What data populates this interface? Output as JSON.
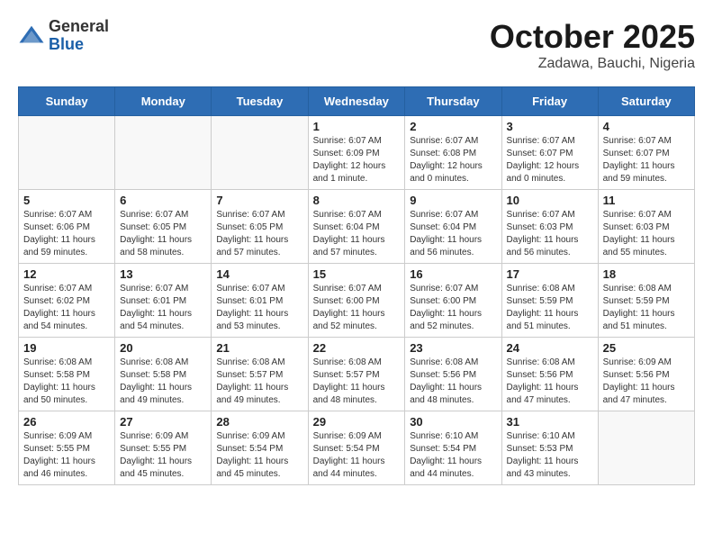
{
  "header": {
    "logo_general": "General",
    "logo_blue": "Blue",
    "month_title": "October 2025",
    "location": "Zadawa, Bauchi, Nigeria"
  },
  "days_of_week": [
    "Sunday",
    "Monday",
    "Tuesday",
    "Wednesday",
    "Thursday",
    "Friday",
    "Saturday"
  ],
  "weeks": [
    [
      {
        "day": "",
        "info": ""
      },
      {
        "day": "",
        "info": ""
      },
      {
        "day": "",
        "info": ""
      },
      {
        "day": "1",
        "info": "Sunrise: 6:07 AM\nSunset: 6:09 PM\nDaylight: 12 hours\nand 1 minute."
      },
      {
        "day": "2",
        "info": "Sunrise: 6:07 AM\nSunset: 6:08 PM\nDaylight: 12 hours\nand 0 minutes."
      },
      {
        "day": "3",
        "info": "Sunrise: 6:07 AM\nSunset: 6:07 PM\nDaylight: 12 hours\nand 0 minutes."
      },
      {
        "day": "4",
        "info": "Sunrise: 6:07 AM\nSunset: 6:07 PM\nDaylight: 11 hours\nand 59 minutes."
      }
    ],
    [
      {
        "day": "5",
        "info": "Sunrise: 6:07 AM\nSunset: 6:06 PM\nDaylight: 11 hours\nand 59 minutes."
      },
      {
        "day": "6",
        "info": "Sunrise: 6:07 AM\nSunset: 6:05 PM\nDaylight: 11 hours\nand 58 minutes."
      },
      {
        "day": "7",
        "info": "Sunrise: 6:07 AM\nSunset: 6:05 PM\nDaylight: 11 hours\nand 57 minutes."
      },
      {
        "day": "8",
        "info": "Sunrise: 6:07 AM\nSunset: 6:04 PM\nDaylight: 11 hours\nand 57 minutes."
      },
      {
        "day": "9",
        "info": "Sunrise: 6:07 AM\nSunset: 6:04 PM\nDaylight: 11 hours\nand 56 minutes."
      },
      {
        "day": "10",
        "info": "Sunrise: 6:07 AM\nSunset: 6:03 PM\nDaylight: 11 hours\nand 56 minutes."
      },
      {
        "day": "11",
        "info": "Sunrise: 6:07 AM\nSunset: 6:03 PM\nDaylight: 11 hours\nand 55 minutes."
      }
    ],
    [
      {
        "day": "12",
        "info": "Sunrise: 6:07 AM\nSunset: 6:02 PM\nDaylight: 11 hours\nand 54 minutes."
      },
      {
        "day": "13",
        "info": "Sunrise: 6:07 AM\nSunset: 6:01 PM\nDaylight: 11 hours\nand 54 minutes."
      },
      {
        "day": "14",
        "info": "Sunrise: 6:07 AM\nSunset: 6:01 PM\nDaylight: 11 hours\nand 53 minutes."
      },
      {
        "day": "15",
        "info": "Sunrise: 6:07 AM\nSunset: 6:00 PM\nDaylight: 11 hours\nand 52 minutes."
      },
      {
        "day": "16",
        "info": "Sunrise: 6:07 AM\nSunset: 6:00 PM\nDaylight: 11 hours\nand 52 minutes."
      },
      {
        "day": "17",
        "info": "Sunrise: 6:08 AM\nSunset: 5:59 PM\nDaylight: 11 hours\nand 51 minutes."
      },
      {
        "day": "18",
        "info": "Sunrise: 6:08 AM\nSunset: 5:59 PM\nDaylight: 11 hours\nand 51 minutes."
      }
    ],
    [
      {
        "day": "19",
        "info": "Sunrise: 6:08 AM\nSunset: 5:58 PM\nDaylight: 11 hours\nand 50 minutes."
      },
      {
        "day": "20",
        "info": "Sunrise: 6:08 AM\nSunset: 5:58 PM\nDaylight: 11 hours\nand 49 minutes."
      },
      {
        "day": "21",
        "info": "Sunrise: 6:08 AM\nSunset: 5:57 PM\nDaylight: 11 hours\nand 49 minutes."
      },
      {
        "day": "22",
        "info": "Sunrise: 6:08 AM\nSunset: 5:57 PM\nDaylight: 11 hours\nand 48 minutes."
      },
      {
        "day": "23",
        "info": "Sunrise: 6:08 AM\nSunset: 5:56 PM\nDaylight: 11 hours\nand 48 minutes."
      },
      {
        "day": "24",
        "info": "Sunrise: 6:08 AM\nSunset: 5:56 PM\nDaylight: 11 hours\nand 47 minutes."
      },
      {
        "day": "25",
        "info": "Sunrise: 6:09 AM\nSunset: 5:56 PM\nDaylight: 11 hours\nand 47 minutes."
      }
    ],
    [
      {
        "day": "26",
        "info": "Sunrise: 6:09 AM\nSunset: 5:55 PM\nDaylight: 11 hours\nand 46 minutes."
      },
      {
        "day": "27",
        "info": "Sunrise: 6:09 AM\nSunset: 5:55 PM\nDaylight: 11 hours\nand 45 minutes."
      },
      {
        "day": "28",
        "info": "Sunrise: 6:09 AM\nSunset: 5:54 PM\nDaylight: 11 hours\nand 45 minutes."
      },
      {
        "day": "29",
        "info": "Sunrise: 6:09 AM\nSunset: 5:54 PM\nDaylight: 11 hours\nand 44 minutes."
      },
      {
        "day": "30",
        "info": "Sunrise: 6:10 AM\nSunset: 5:54 PM\nDaylight: 11 hours\nand 44 minutes."
      },
      {
        "day": "31",
        "info": "Sunrise: 6:10 AM\nSunset: 5:53 PM\nDaylight: 11 hours\nand 43 minutes."
      },
      {
        "day": "",
        "info": ""
      }
    ]
  ]
}
